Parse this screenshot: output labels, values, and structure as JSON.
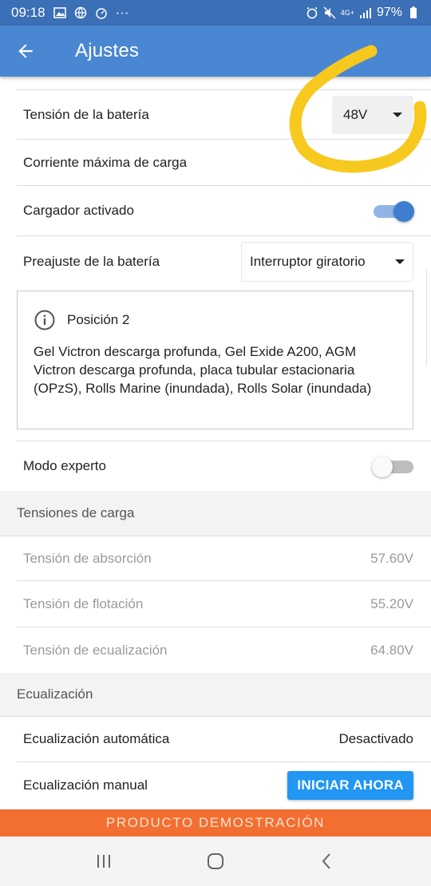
{
  "status_bar": {
    "time": "09:18",
    "ellipsis": "···",
    "network": "4G+",
    "battery": "97%"
  },
  "app_bar": {
    "title": "Ajustes"
  },
  "settings": {
    "battery_voltage": {
      "label": "Tensión de la batería",
      "value": "48V"
    },
    "max_charge_current": {
      "label": "Corriente máxima de carga"
    },
    "charger_enabled": {
      "label": "Cargador activado",
      "on": true
    },
    "battery_preset": {
      "label": "Preajuste de la batería",
      "value": "Interruptor giratorio"
    },
    "info": {
      "title": "Posición 2",
      "text": "Gel Victron descarga profunda, Gel Exide A200, AGM Victron descarga profunda, placa tubular estacionaria (OPzS), Rolls Marine (inundada), Rolls Solar (inundada)"
    },
    "expert_mode": {
      "label": "Modo experto",
      "on": false
    }
  },
  "charge_voltages": {
    "header": "Tensiones de carga",
    "rows": [
      {
        "label": "Tensión de absorción",
        "value": "57.60V"
      },
      {
        "label": "Tensión de flotación",
        "value": "55.20V"
      },
      {
        "label": "Tensión de ecualización",
        "value": "64.80V"
      }
    ]
  },
  "equalization": {
    "header": "Ecualización",
    "automatic": {
      "label": "Ecualización automática",
      "value": "Desactivado"
    },
    "manual": {
      "label": "Ecualización manual",
      "button": "INICIAR AHORA"
    }
  },
  "demo_banner": "PRODUCTO DEMOSTRACIÓN",
  "colors": {
    "status_bar": "#3b6fb6",
    "app_bar": "#4a87d2",
    "accent": "#2196f3",
    "demo_banner": "#f36f31",
    "annotation": "#f7c91e"
  },
  "icons": [
    "back-arrow-icon",
    "info-icon",
    "recents-icon",
    "home-icon",
    "nav-back-icon"
  ]
}
